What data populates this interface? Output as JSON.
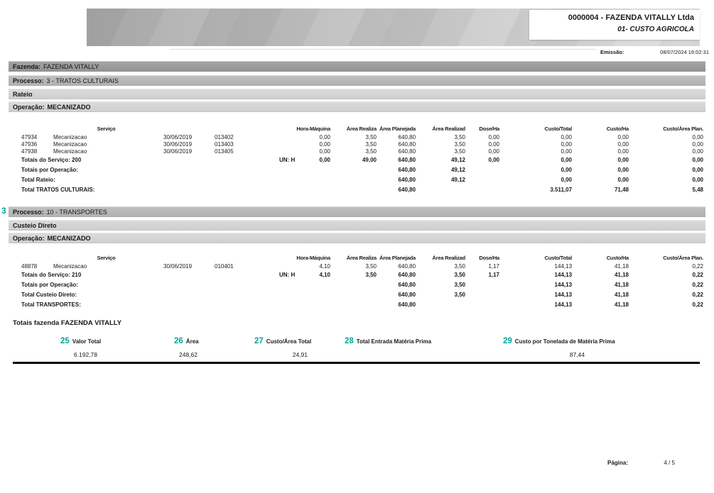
{
  "colors": {
    "accent_teal": "#00a79d",
    "band_dark": "#999999",
    "band_medium": "#b7b7b7",
    "band_light": "#d4d4d4"
  },
  "header": {
    "company_line": "0000004 - FAZENDA VITALLY Ltda",
    "report_title": "01- CUSTO AGRICOLA",
    "emission_label": "Emissão:",
    "emission_value": "08/07/2024 16:02:31"
  },
  "bands": [
    {
      "label": "Fazenda:",
      "value": "FAZENDA VITALLY"
    },
    {
      "label": "Processo:",
      "value": "3 - TRATOS CULTURAIS"
    },
    {
      "label": "Rateio",
      "value": ""
    },
    {
      "label": "Operação:",
      "value": "MECANIZADO"
    },
    {
      "label": "Processo:",
      "value": "10 - TRANSPORTES",
      "marker": "3"
    },
    {
      "label": "Custeio Direto",
      "value": ""
    },
    {
      "label": "Operação:",
      "value": "MECANIZADO"
    }
  ],
  "table_header": {
    "servico": "Serviço",
    "cols": [
      "Hora-Máquina",
      "Área Realiza",
      "Área Planejada",
      "Área Realizad",
      "Dose/Ha",
      "Custo/Total",
      "Custo/Ha",
      "Custo/Área Plan."
    ]
  },
  "tables": [
    {
      "rows": [
        {
          "type": "data",
          "id": "47934",
          "name": "Mecanizacao",
          "date": "30/06/2019",
          "code": "013402",
          "vals": {
            "hm": "0,00",
            "ar": "3,50",
            "ap": "640,80",
            "ard": "3,50",
            "dose": "0,00",
            "ct": "0,00",
            "cha": "0,00",
            "cap": "0,00"
          }
        },
        {
          "type": "data",
          "id": "47936",
          "name": "Mecanizacao",
          "date": "30/06/2019",
          "code": "013403",
          "vals": {
            "hm": "0,00",
            "ar": "3,50",
            "ap": "640,80",
            "ard": "3,50",
            "dose": "0,00",
            "ct": "0,00",
            "cha": "0,00",
            "cap": "0,00"
          }
        },
        {
          "type": "data",
          "id": "47938",
          "name": "Mecanizacao",
          "date": "30/06/2019",
          "code": "013405",
          "vals": {
            "hm": "0,00",
            "ar": "3,50",
            "ap": "640,80",
            "ard": "3,50",
            "dose": "0,00",
            "ct": "0,00",
            "cha": "0,00",
            "cap": "0,00"
          }
        },
        {
          "type": "total",
          "label": "Totais do Serviço: 200",
          "un": "UN: H",
          "vals": {
            "hm": "0,00",
            "ar": "49,00",
            "ap": "640,80",
            "ard": "49,12",
            "dose": "0,00",
            "ct": "0,00",
            "cha": "0,00",
            "cap": "0,00"
          }
        },
        {
          "type": "total",
          "label": "Totais por Operação:",
          "un": "",
          "vals": {
            "ap": "640,80",
            "ard": "49,12",
            "ct": "0,00",
            "cha": "0,00",
            "cap": "0,00"
          }
        },
        {
          "type": "total",
          "label": "Total Rateio:",
          "un": "",
          "vals": {
            "ap": "640,80",
            "ard": "49,12",
            "ct": "0,00",
            "cha": "0,00",
            "cap": "0,00"
          }
        },
        {
          "type": "total",
          "label": "Total TRATOS CULTURAIS:",
          "un": "",
          "vals": {
            "ap": "640,80",
            "ct": "3.511,07",
            "cha": "71,48",
            "cap": "5,48"
          }
        }
      ]
    },
    {
      "rows": [
        {
          "type": "data",
          "id": "48878",
          "name": "Mecanizacao",
          "date": "30/06/2019",
          "code": "010401",
          "vals": {
            "hm": "4,10",
            "ar": "3,50",
            "ap": "640,80",
            "ard": "3,50",
            "dose": "1,17",
            "ct": "144,13",
            "cha": "41,18",
            "cap": "0,22"
          }
        },
        {
          "type": "total",
          "label": "Totais do Serviço: 210",
          "un": "UN: H",
          "vals": {
            "hm": "4,10",
            "ar": "3,50",
            "ap": "640,80",
            "ard": "3,50",
            "dose": "1,17",
            "ct": "144,13",
            "cha": "41,18",
            "cap": "0,22"
          }
        },
        {
          "type": "total",
          "label": "Totais por Operação:",
          "un": "",
          "vals": {
            "ap": "640,80",
            "ard": "3,50",
            "ct": "144,13",
            "cha": "41,18",
            "cap": "0,22"
          }
        },
        {
          "type": "total",
          "label": "Total Custeio Direto:",
          "un": "",
          "vals": {
            "ap": "640,80",
            "ard": "3,50",
            "ct": "144,13",
            "cha": "41,18",
            "cap": "0,22"
          }
        },
        {
          "type": "total",
          "label": "Total TRANSPORTES:",
          "un": "",
          "vals": {
            "ap": "640,80",
            "ct": "144,13",
            "cha": "41,18",
            "cap": "0,22"
          }
        }
      ]
    }
  ],
  "summary": {
    "title": "Totais fazenda FAZENDA VITALLY",
    "metrics": [
      {
        "num": "25",
        "label": "Valor Total",
        "value": "6.192,78"
      },
      {
        "num": "26",
        "label": "Área",
        "value": "248,62"
      },
      {
        "num": "27",
        "label": "Custo/Área Total",
        "value": "24,91"
      },
      {
        "num": "28",
        "label": "Total Entrada Matéria Prima",
        "value": ""
      },
      {
        "num": "29",
        "label": "Custo por Tonelada de Matéria Prima",
        "value": "87,44"
      }
    ]
  },
  "footer": {
    "page_label": "Página:",
    "page_value": "4 / 5"
  }
}
